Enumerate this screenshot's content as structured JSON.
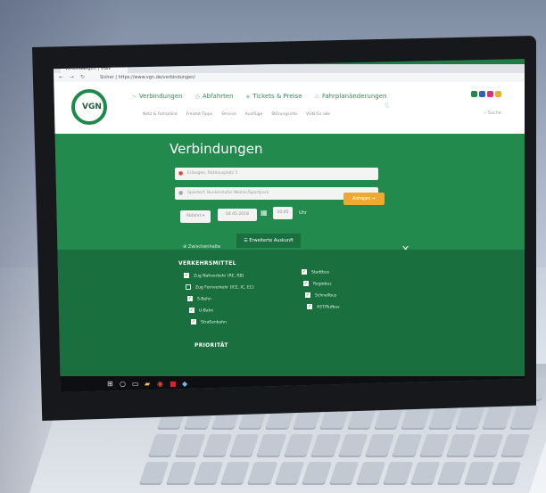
{
  "browser": {
    "tab_title": "Verbindungen | VGN",
    "url": "Sicher | https://www.vgn.de/verbindungen/"
  },
  "site": {
    "logo_text": "VGN",
    "main_nav": [
      "Verbindungen",
      "Abfahrten",
      "Tickets & Preise",
      "Fahrplanänderungen"
    ],
    "sub_nav": [
      "Netz & Fahrpläne",
      "Freizeit-Tipps",
      "Service",
      "Ausflüge",
      "Störungsinfo",
      "VGN für alle"
    ],
    "search_label": "Suche",
    "brand_colors": [
      "#1e8a4a",
      "#2a62b8",
      "#d6337a",
      "#e8b12c"
    ]
  },
  "form": {
    "title": "Verbindungen",
    "origin": "Erlangen, Rathausplatz 1",
    "destination": "Spardorf, Buckenhofer Weiher/Sportpark",
    "mode": "Abfahrt",
    "date": "04.05.2018",
    "time": "10:45",
    "time_unit": "Uhr",
    "search_button": "Anfragen",
    "tab_via": "Zwischenhalte",
    "tab_advanced": "Erweiterte Auskunft"
  },
  "options": {
    "transport_heading": "VERKEHRSMITTEL",
    "transport_left": [
      {
        "label": "Zug Nahverkehr (RE, RB)",
        "checked": true
      },
      {
        "label": "Zug Fernverkehr (ICE, IC, EC)",
        "checked": false
      },
      {
        "label": "S-Bahn",
        "checked": true
      },
      {
        "label": "U-Bahn",
        "checked": true
      },
      {
        "label": "Straßenbahn",
        "checked": true
      }
    ],
    "transport_right": [
      {
        "label": "Stadtbus",
        "checked": true
      },
      {
        "label": "Regiobus",
        "checked": true
      },
      {
        "label": "Schnellbus",
        "checked": true
      },
      {
        "label": "AST/Rufbus",
        "checked": true
      }
    ],
    "priority_heading": "PRIORITÄT"
  },
  "accent_colors": {
    "green": "#238a4e",
    "dark_green": "#1a6f3f",
    "orange": "#f0a830"
  }
}
